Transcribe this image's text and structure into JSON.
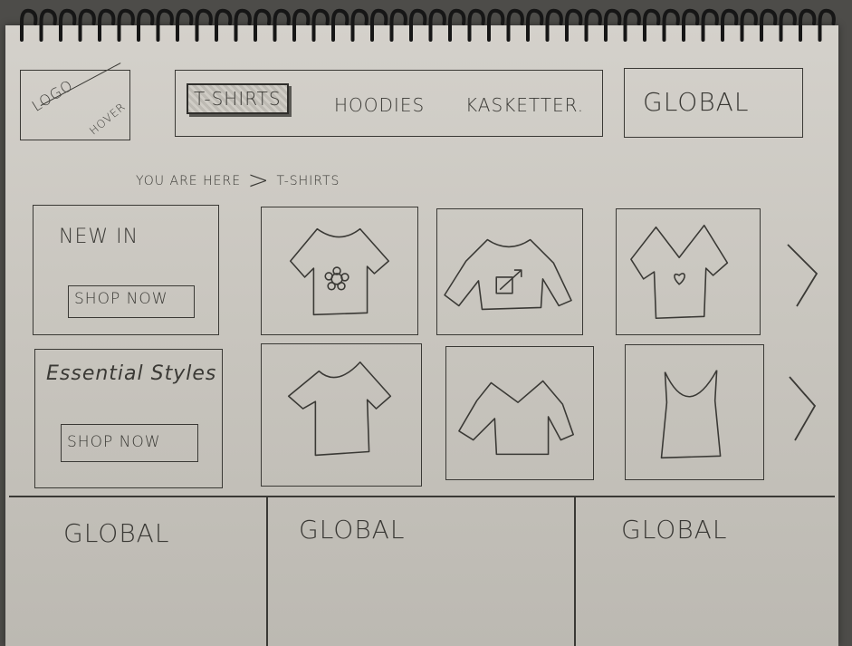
{
  "header": {
    "logo": {
      "text": "LOGO",
      "subtext": "HOVER"
    },
    "nav": [
      {
        "label": "T-SHIRTS",
        "active": true
      },
      {
        "label": "HOODIES",
        "active": false
      },
      {
        "label": "KASKETTER.",
        "active": false
      }
    ],
    "global_label": "GLOBAL"
  },
  "breadcrumb": {
    "prefix": "YOU ARE HERE",
    "separator": ">",
    "current": "T-SHIRTS"
  },
  "promos": [
    {
      "title": "NEW IN",
      "button_label": "SHOP NOW"
    },
    {
      "title": "Essential Styles",
      "button_label": "SHOP NOW"
    }
  ],
  "products": [
    {
      "row": 1,
      "icon": "tshirt-flower-icon"
    },
    {
      "row": 1,
      "icon": "sweater-arrow-icon"
    },
    {
      "row": 1,
      "icon": "vneck-heart-icon"
    },
    {
      "row": 2,
      "icon": "tshirt-plain-icon"
    },
    {
      "row": 2,
      "icon": "sweater-vneck-icon"
    },
    {
      "row": 2,
      "icon": "tanktop-icon"
    }
  ],
  "carousel": {
    "next_icon": "chevron-right-icon"
  },
  "footer": [
    {
      "label": "GLOBAL"
    },
    {
      "label": "GLOBAL"
    },
    {
      "label": "GLOBAL"
    }
  ],
  "colors": {
    "paper": "#c9c6bf",
    "ink": "#3a3935",
    "background": "#4d4c49"
  }
}
